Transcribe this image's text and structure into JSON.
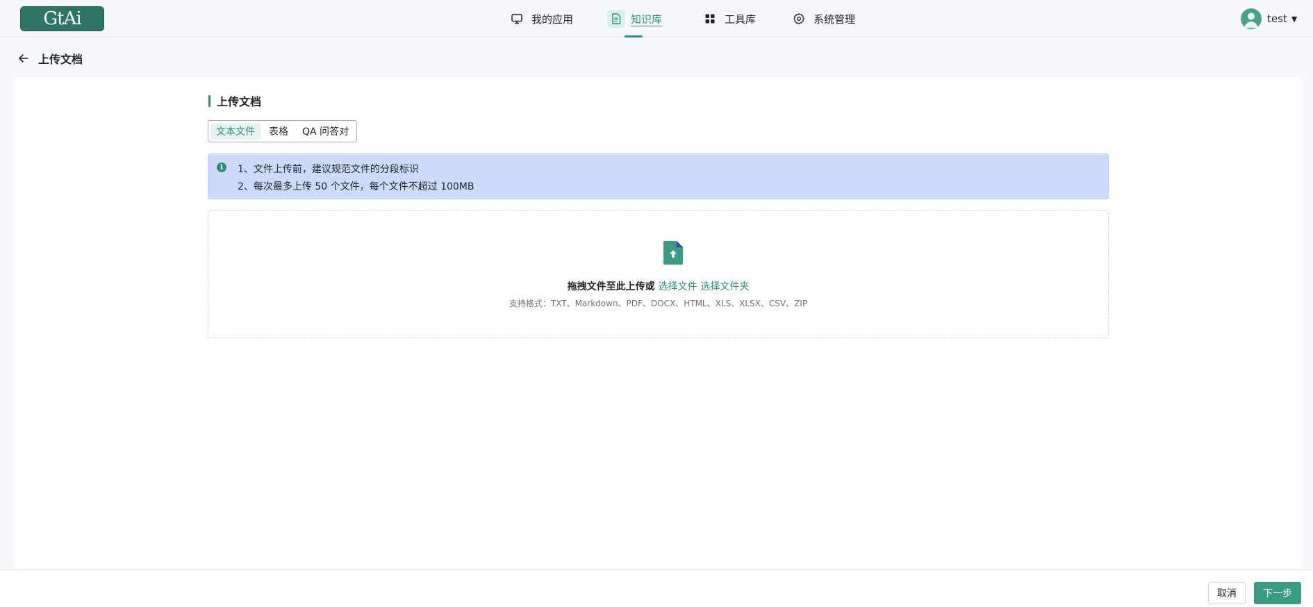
{
  "header": {
    "logo_text": "GtAi",
    "nav": [
      {
        "label": "我的应用",
        "icon": "monitor-icon"
      },
      {
        "label": "知识库",
        "icon": "document-icon",
        "active": true
      },
      {
        "label": "工具库",
        "icon": "grid-icon"
      },
      {
        "label": "系统管理",
        "icon": "gear-icon"
      }
    ],
    "user": {
      "name": "test",
      "avatar_icon": "user-avatar-icon",
      "menu_icon": "caret-down-icon"
    }
  },
  "page": {
    "title": "上传文档",
    "back_icon": "arrow-left-icon"
  },
  "upload": {
    "section_title": "上传文档",
    "tabs": [
      {
        "label": "文本文件",
        "active": true
      },
      {
        "label": "表格"
      },
      {
        "label": "QA 问答对"
      }
    ],
    "notice": {
      "icon": "info-icon",
      "line1": "1、文件上传前，建议规范文件的分段标识",
      "line2": "2、每次最多上传 50 个文件，每个文件不超过 100MB"
    },
    "dropzone": {
      "icon": "file-upload-icon",
      "text": "拖拽文件至此上传或",
      "select_file": "选择文件",
      "select_folder": "选择文件夹",
      "formats": "支持格式：TXT、Markdown、PDF、DOCX、HTML、XLS、XLSX、CSV、ZIP"
    }
  },
  "footer": {
    "cancel_label": "取消",
    "next_label": "下一步"
  },
  "colors": {
    "accent": "#2e8f79",
    "notice_bg": "#cedaf9",
    "logo_bg": "#2f7566"
  }
}
